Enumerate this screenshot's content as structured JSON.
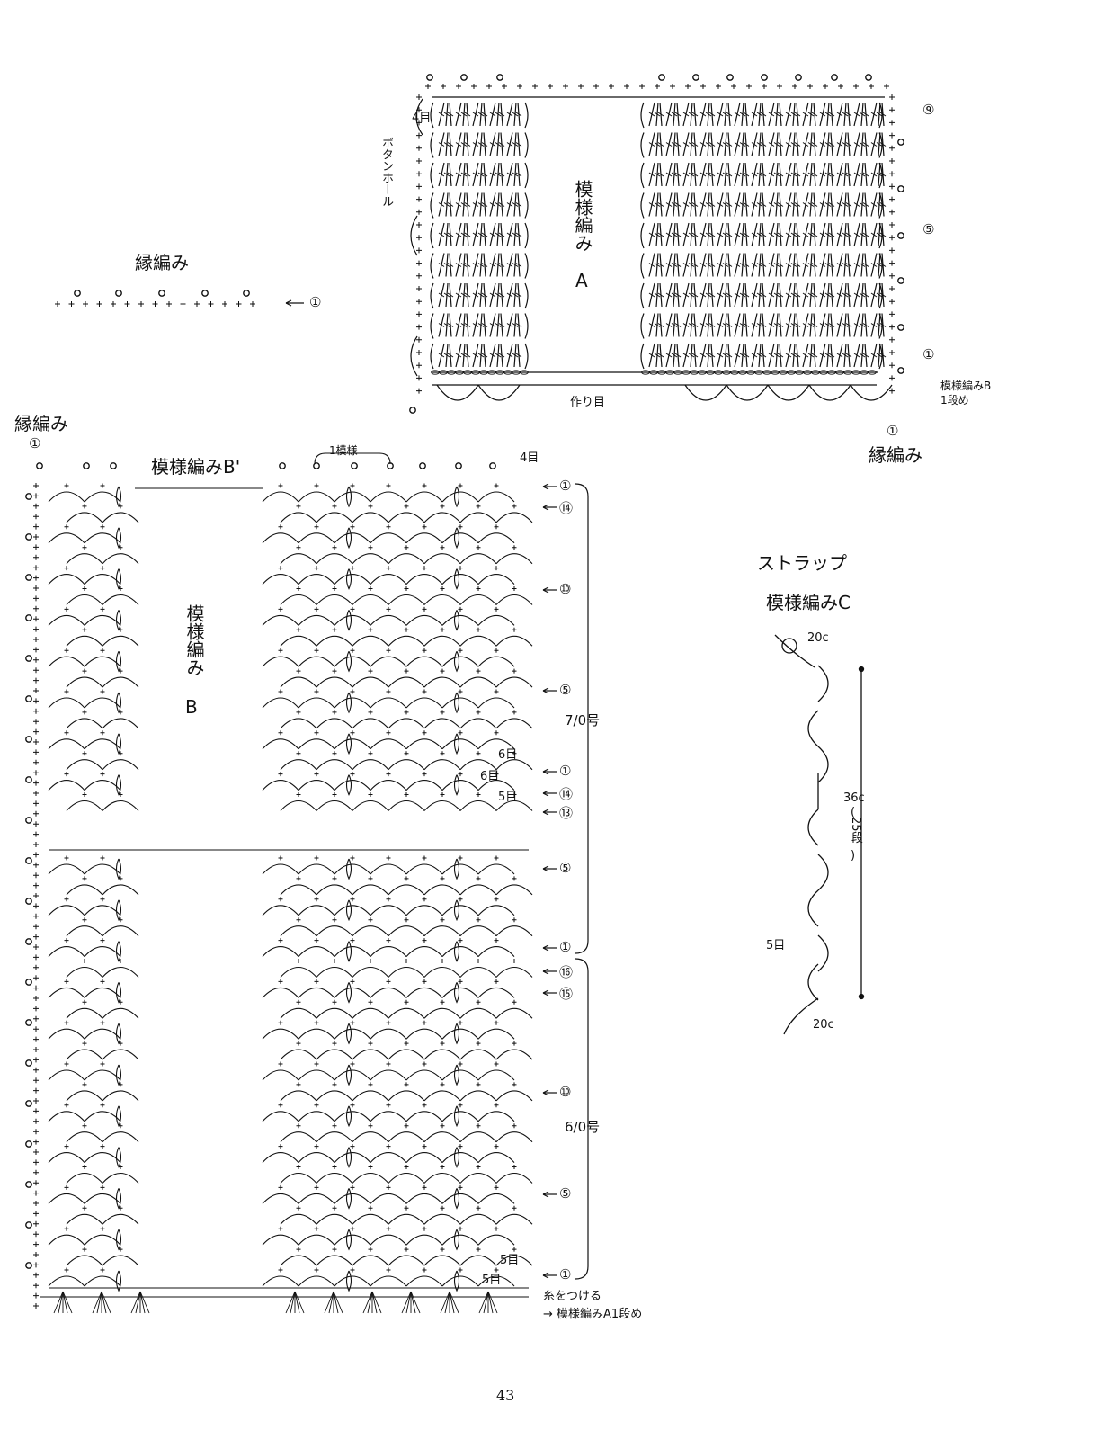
{
  "labels": {
    "edging_small": "縁編み",
    "edging_small_row": "①",
    "edging_left": "縁編み",
    "edging_left_row": "①",
    "buttonhole": "ボタンホール",
    "pattern_a_title": "模様編み",
    "pattern_a_letter": "A",
    "pattern_a_4me": "4目",
    "foundation": "作り目",
    "pattern_a_row9": "⑨",
    "pattern_a_row5": "⑤",
    "pattern_a_row1": "①",
    "to_b_row1_a": "模様編みB",
    "to_b_row1_b": "1段め",
    "edging_right_row": "①",
    "edging_right": "縁編み",
    "pattern_b_prime": "模様編みB'",
    "one_repeat": "1模様",
    "b_4me": "4目",
    "pattern_b_title": "模様編み",
    "pattern_b_letter": "B",
    "needle_7": "7/0号",
    "needle_6": "6/0号",
    "six_me_1": "6目",
    "six_me_2": "6目",
    "five_me_1": "5目",
    "five_me_2": "5目",
    "five_me_3": "5目",
    "attach_yarn": "糸をつける",
    "to_a_row1": "→ 模様編みA1段め",
    "strap": "ストラップ",
    "pattern_c": "模様編みC",
    "strap_20c_top": "20c",
    "strap_20c_bottom": "20c",
    "strap_36c": "36c",
    "strap_rows_paren_open": "(",
    "strap_rows": "25段",
    "strap_rows_paren_close": ")",
    "strap_5me": "5目",
    "page_number": "43"
  },
  "row_markers_b": [
    "①",
    "⑭",
    "⑩",
    "⑤",
    "①",
    "⑭",
    "⑬",
    "⑤",
    "①",
    "⑯",
    "⑮",
    "⑩",
    "⑤",
    "①"
  ],
  "colors": {
    "ink": "#111111",
    "paper": "#ffffff"
  }
}
